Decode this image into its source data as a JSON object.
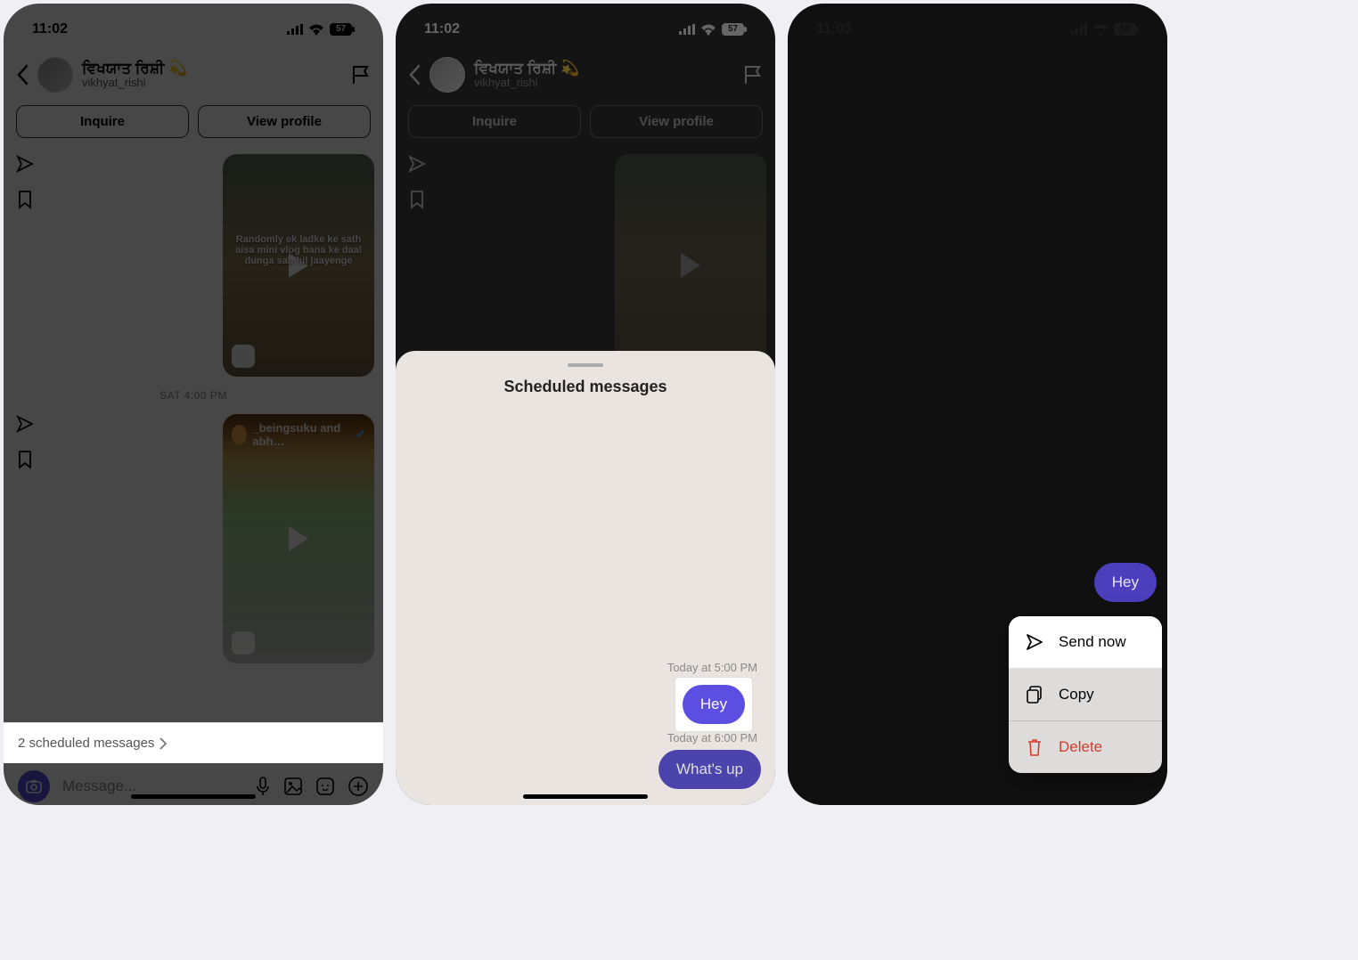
{
  "screens": {
    "s1": {
      "status": {
        "time": "11:02",
        "battery": "57"
      },
      "header": {
        "display_name": "ਵਿਖਯਾਤ ਰਿਸ਼ੀ 💫",
        "username": "vikhyat_rishi"
      },
      "buttons": {
        "inquire": "Inquire",
        "view_profile": "View profile"
      },
      "media1": {
        "caption": "Randomly ek ladke ke sath aisa mini vlog bana ke daal dunga sab hil jaayenge"
      },
      "timestamp": "SAT 4:00 PM",
      "media2": {
        "overlay_name": "_beingsuku and abh…"
      },
      "scheduled_strip": "2 scheduled messages",
      "input_placeholder": "Message..."
    },
    "s2": {
      "status": {
        "time": "11:02",
        "battery": "57"
      },
      "header": {
        "display_name": "ਵਿਖਯਾਤ ਰਿਸ਼ੀ 💫",
        "username": "vikhyat_rishi"
      },
      "buttons": {
        "inquire": "Inquire",
        "view_profile": "View profile"
      },
      "sheet": {
        "title": "Scheduled messages",
        "items": [
          {
            "time": "Today at 5:00 PM",
            "text": "Hey"
          },
          {
            "time": "Today at 6:00 PM",
            "text": "What's up"
          }
        ]
      }
    },
    "s3": {
      "status": {
        "time": "11:03",
        "battery": "56"
      },
      "bubble_text": "Hey",
      "menu": {
        "send_now": "Send now",
        "copy": "Copy",
        "delete": "Delete"
      }
    }
  }
}
